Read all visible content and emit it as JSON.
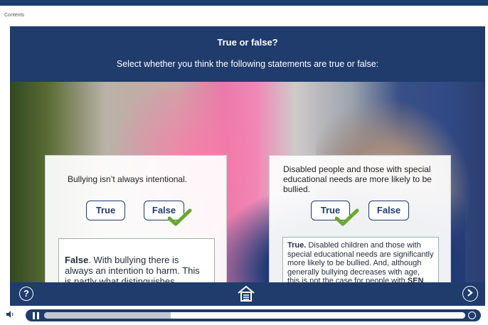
{
  "top": {
    "contents_label": "Contents"
  },
  "header": {
    "title": "True or false?",
    "subtitle": "Select whether you think the following statements are true or false:"
  },
  "cards": [
    {
      "statement": "Bullying isn’t always intentional.",
      "true_label": "True",
      "false_label": "False",
      "selected": "False",
      "feedback_bold": "False",
      "feedback_text": ". With bullying there is always an intention to harm. This is partly what distinguishes bullying from teasing."
    },
    {
      "statement": "Disabled people and those with special educational needs are more likely to be bullied.",
      "true_label": "True",
      "false_label": "False",
      "selected": "True",
      "feedback_bold": "True.",
      "feedback_text": " Disabled children and those with special educational needs are significantly more likely to be bullied. And, although generally bullying decreases with age, this is not the case for people with ",
      "feedback_bold_end": "SEN",
      "feedback_end": "."
    }
  ],
  "nav": {
    "help_label": "?",
    "icons": [
      "help-icon",
      "home-icon",
      "next-icon"
    ]
  },
  "player": {
    "progress_fraction": 0.3,
    "icons": [
      "volume-icon",
      "pause-icon",
      "replay-icon"
    ]
  },
  "colors": {
    "navy": "#1f3c6c",
    "check_green": "#6aa733"
  }
}
